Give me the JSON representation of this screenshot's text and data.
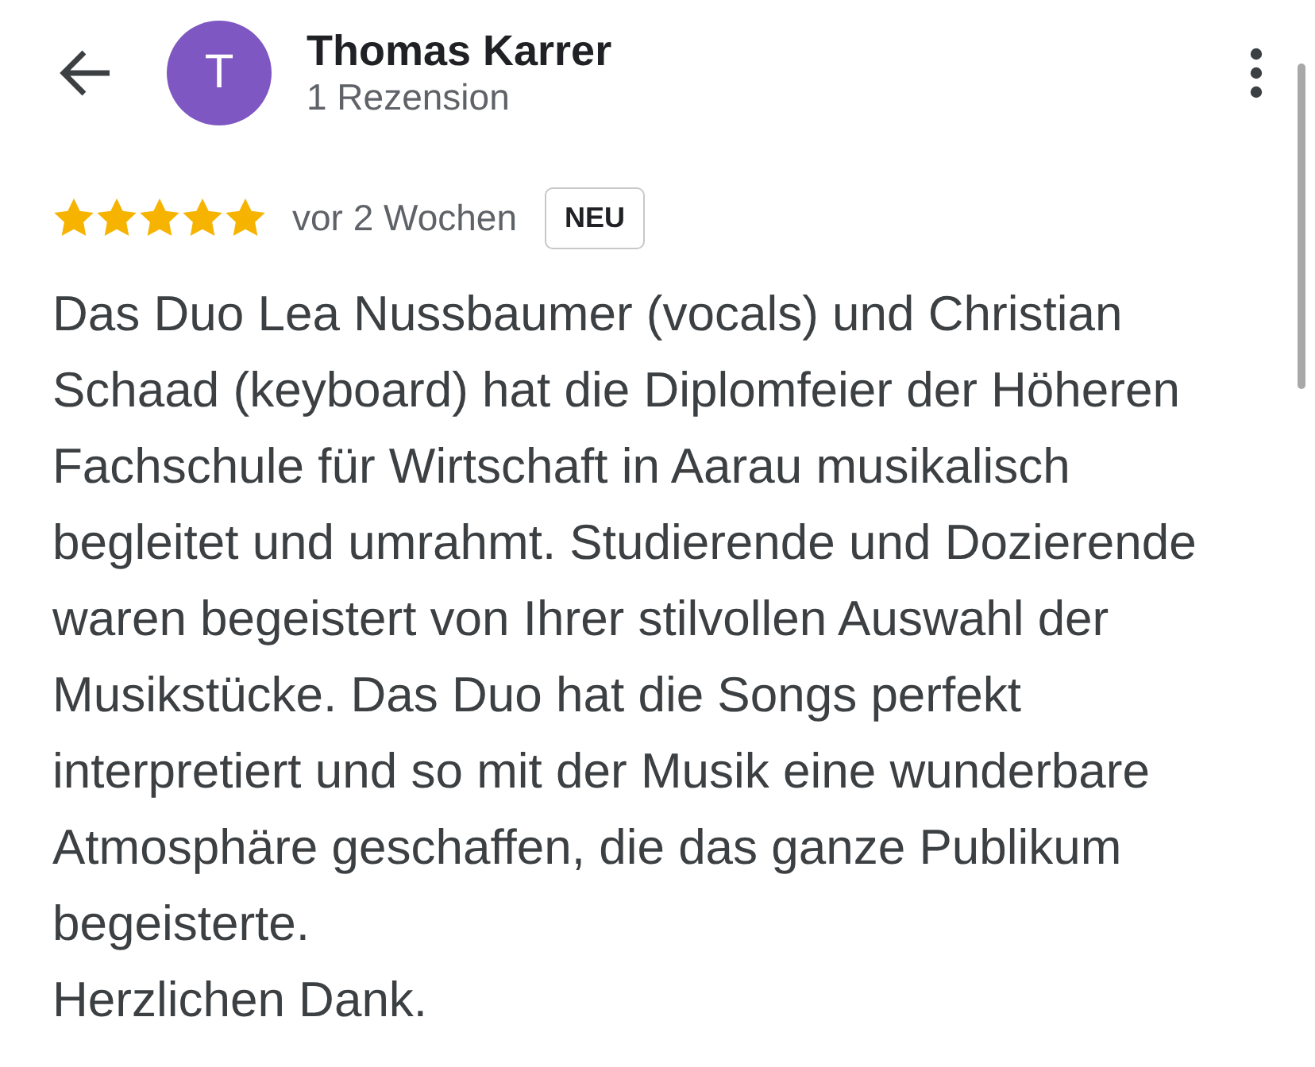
{
  "header": {
    "avatar_letter": "T",
    "name": "Thomas Karrer",
    "subtitle": "1 Rezension"
  },
  "review": {
    "stars": 5,
    "time": "vor 2 Wochen",
    "badge": "NEU",
    "paragraphs": [
      "Das Duo Lea Nussbaumer (vocals) und Christian Schaad (keyboard) hat die Diplomfeier der Höheren Fachschule für Wirtschaft in Aarau musikalisch begleitet und umrahmt. Studierende und Dozierende waren begeistert von Ihrer stilvollen Auswahl der Musikstücke. Das Duo hat die Songs perfekt interpretiert und so mit der Musik eine wunderbare Atmosphäre geschaffen, die das ganze Publikum begeisterte.",
      "Herzlichen Dank."
    ]
  }
}
